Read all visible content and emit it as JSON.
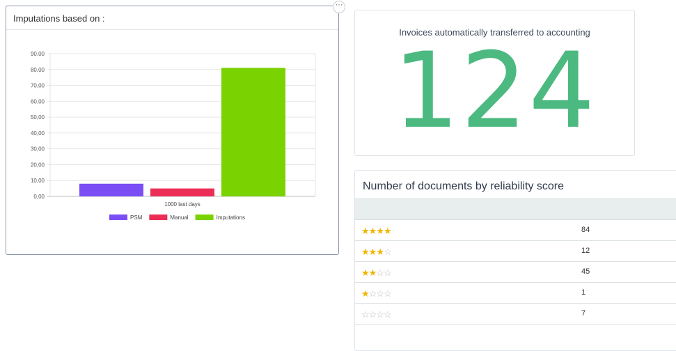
{
  "left_panel": {
    "title": "Imputations based on :",
    "menu_icon": "ellipsis-icon",
    "menu_glyph": "···"
  },
  "chart_data": {
    "type": "bar",
    "categories": [
      "1000 last days"
    ],
    "series": [
      {
        "name": "PSM",
        "values": [
          8
        ],
        "color": "#7b4df5"
      },
      {
        "name": "Manual",
        "values": [
          5
        ],
        "color": "#ec2e57"
      },
      {
        "name": "Imputations",
        "values": [
          81
        ],
        "color": "#7ad200"
      }
    ],
    "ylim": [
      0,
      90
    ],
    "yticks": [
      "0,00",
      "10,00",
      "20,00",
      "30,00",
      "40,00",
      "50,00",
      "60,00",
      "70,00",
      "80,00",
      "90,00"
    ],
    "grid": true,
    "legend_position": "bottom"
  },
  "kpi": {
    "title": "Invoices automatically transferred to accounting",
    "value": "124",
    "color": "#4cb981"
  },
  "reliability": {
    "title": "Number of documents by reliability score",
    "star_color": "#f2b400",
    "rows": [
      {
        "filled": 4,
        "count": "84"
      },
      {
        "filled": 3,
        "count": "12"
      },
      {
        "filled": 2,
        "count": "45"
      },
      {
        "filled": 1,
        "count": "1"
      },
      {
        "filled": 0,
        "count": "7"
      }
    ]
  }
}
